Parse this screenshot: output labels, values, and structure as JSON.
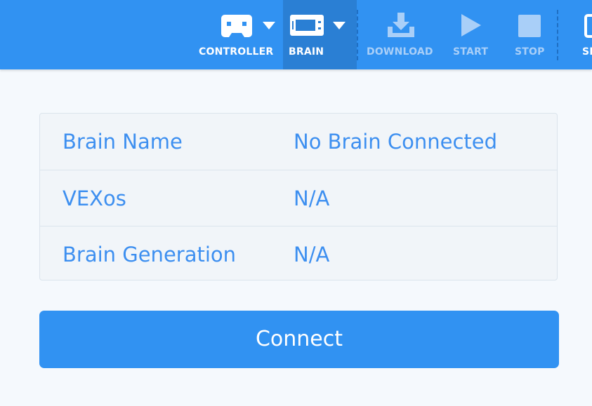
{
  "toolbar": {
    "items": [
      {
        "label": "CONTROLLER",
        "icon": "controller-icon",
        "state": "enabled"
      },
      {
        "label": "BRAIN",
        "icon": "brain-icon",
        "state": "active"
      },
      {
        "label": "DOWNLOAD",
        "icon": "download-icon",
        "state": "disabled"
      },
      {
        "label": "START",
        "icon": "play-icon",
        "state": "disabled"
      },
      {
        "label": "STOP",
        "icon": "stop-icon",
        "state": "disabled"
      },
      {
        "label": "SH",
        "icon": "share-icon",
        "state": "enabled"
      }
    ]
  },
  "info": {
    "rows": [
      {
        "key": "Brain Name",
        "value": "No Brain Connected"
      },
      {
        "key": "VEXos",
        "value": "N/A"
      },
      {
        "key": "Brain Generation",
        "value": "N/A"
      }
    ]
  },
  "connect_label": "Connect",
  "colors": {
    "toolbar_bg": "#3192f2",
    "active_tab_bg": "#2a7fd4",
    "disabled": "#a9cff8",
    "text_blue": "#3d8ff0",
    "button_bg": "#3192f2"
  }
}
